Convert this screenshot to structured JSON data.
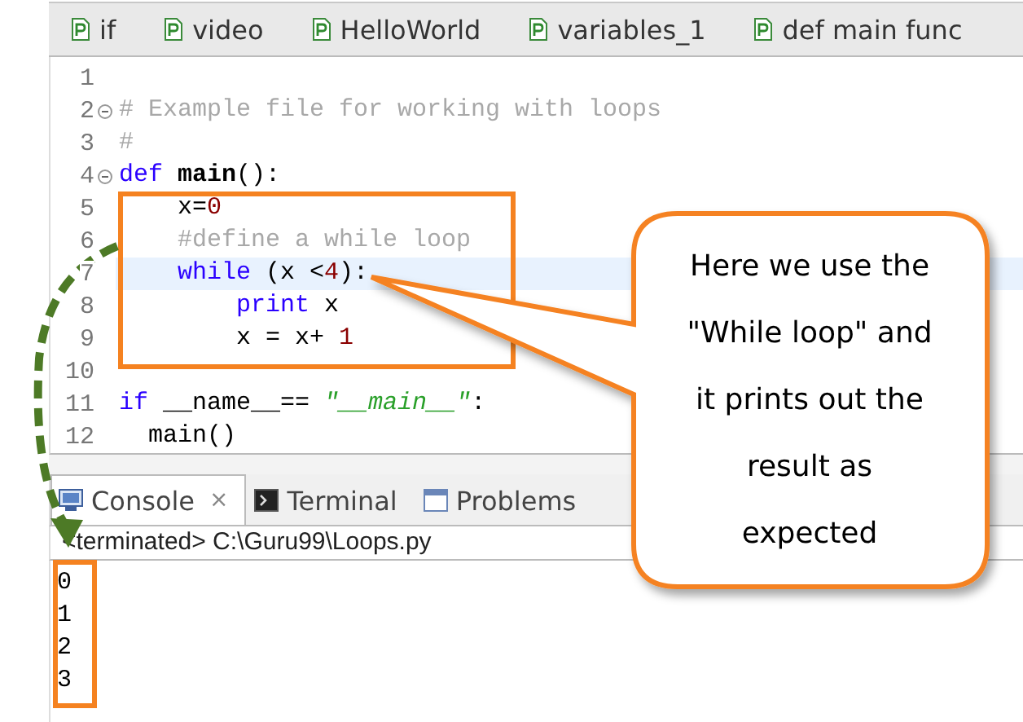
{
  "editor_tabs": [
    {
      "label": "if"
    },
    {
      "label": "video"
    },
    {
      "label": "HelloWorld"
    },
    {
      "label": "variables_1"
    },
    {
      "label": "def main func"
    }
  ],
  "code_lines": [
    {
      "number": "1",
      "fold": false,
      "highlighted": false
    },
    {
      "number": "2",
      "fold": true,
      "highlighted": false,
      "tokens": [
        {
          "kind": "comment",
          "text": "# Example file for working with loops"
        }
      ]
    },
    {
      "number": "3",
      "fold": false,
      "highlighted": false,
      "tokens": [
        {
          "kind": "comment",
          "text": "#"
        }
      ]
    },
    {
      "number": "4",
      "fold": true,
      "highlighted": false,
      "tokens": [
        {
          "kind": "keyword",
          "text": "def "
        },
        {
          "kind": "name",
          "text": "main"
        },
        {
          "kind": "plain",
          "text": "():"
        }
      ]
    },
    {
      "number": "5",
      "fold": false,
      "highlighted": false,
      "tokens": [
        {
          "kind": "plain",
          "text": "    x="
        },
        {
          "kind": "number",
          "text": "0"
        }
      ]
    },
    {
      "number": "6",
      "fold": false,
      "highlighted": false,
      "tokens": [
        {
          "kind": "comment",
          "text": "    #define a while loop"
        }
      ]
    },
    {
      "number": "7",
      "fold": false,
      "highlighted": true,
      "tokens": [
        {
          "kind": "keyword",
          "text": "    while "
        },
        {
          "kind": "plain",
          "text": "(x <"
        },
        {
          "kind": "number",
          "text": "4"
        },
        {
          "kind": "plain",
          "text": "):"
        }
      ]
    },
    {
      "number": "8",
      "fold": false,
      "highlighted": false,
      "tokens": [
        {
          "kind": "keyword",
          "text": "        print "
        },
        {
          "kind": "plain",
          "text": "x"
        }
      ]
    },
    {
      "number": "9",
      "fold": false,
      "highlighted": false,
      "tokens": [
        {
          "kind": "plain",
          "text": "        x = x+ "
        },
        {
          "kind": "number",
          "text": "1"
        }
      ]
    },
    {
      "number": "10",
      "fold": false,
      "highlighted": false
    },
    {
      "number": "11",
      "fold": false,
      "highlighted": false,
      "tokens": [
        {
          "kind": "keyword",
          "text": "if "
        },
        {
          "kind": "plain",
          "text": "__name__== "
        },
        {
          "kind": "string",
          "text": "\"__main__\""
        },
        {
          "kind": "plain",
          "text": ":"
        }
      ]
    },
    {
      "number": "12",
      "fold": false,
      "highlighted": false,
      "tokens": [
        {
          "kind": "plain",
          "text": "  main()"
        }
      ]
    }
  ],
  "console_tabs": [
    {
      "kind": "console",
      "label": "Console",
      "close": "×",
      "selected": true
    },
    {
      "kind": "terminal",
      "label": "Terminal",
      "selected": false
    },
    {
      "kind": "problems",
      "label": "Problems",
      "selected": false
    }
  ],
  "console": {
    "status": "<terminated> C:\\Guru99\\Loops.py",
    "output": [
      "0",
      "1",
      "2",
      "3"
    ]
  },
  "callout": {
    "text": "Here we use the \"While loop\" and it prints out the result as expected"
  }
}
